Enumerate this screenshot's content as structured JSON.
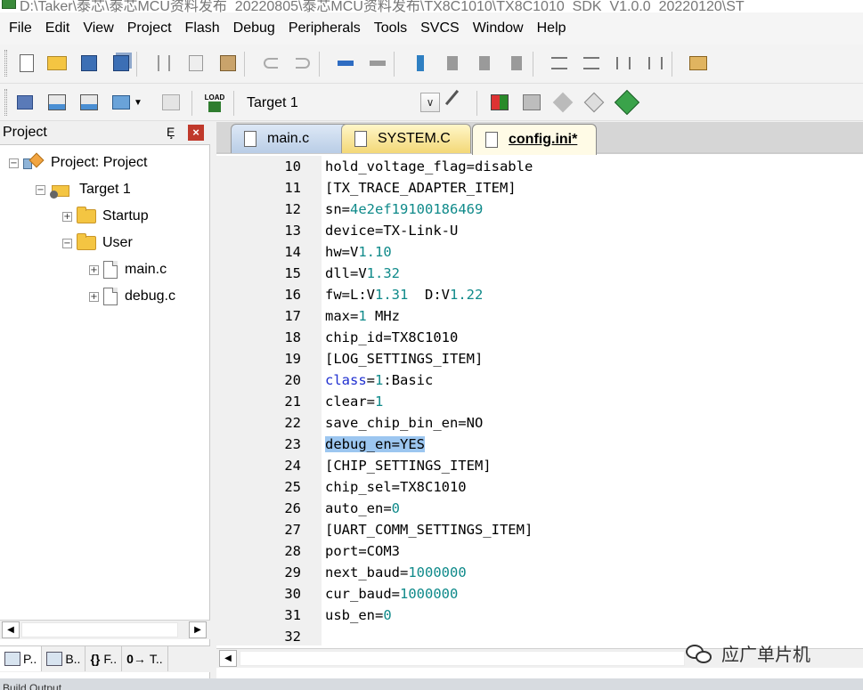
{
  "window": {
    "title": "D:\\Taker\\泰芯\\泰芯MCU资料发布_20220805\\泰芯MCU资料发布\\TX8C1010\\TX8C1010_SDK_V1.0.0_20220120\\ST"
  },
  "menu": [
    "File",
    "Edit",
    "View",
    "Project",
    "Flash",
    "Debug",
    "Peripherals",
    "Tools",
    "SVCS",
    "Window",
    "Help"
  ],
  "toolbar1": {
    "icons": [
      "new-file-icon",
      "open-folder-icon",
      "save-icon",
      "save-all-icon",
      "cut-icon",
      "copy-icon",
      "paste-icon",
      "undo-icon",
      "redo-icon",
      "navigate-back-icon",
      "navigate-forward-icon",
      "insert-bookmark-icon",
      "previous-bookmark-icon",
      "next-bookmark-icon",
      "clear-bookmarks-icon",
      "indent-icon",
      "unindent-icon",
      "comment-icon",
      "uncomment-icon",
      "find-in-files-icon"
    ]
  },
  "toolbar2": {
    "target_value": "Target 1",
    "load_label": "LOAD"
  },
  "project_panel": {
    "title": "Project",
    "pin": "Ȩ",
    "close": "×",
    "tree": [
      {
        "label": "Project: Project",
        "level": 0,
        "expander": "−",
        "type": "project"
      },
      {
        "label": "Target 1",
        "level": 1,
        "expander": "−",
        "type": "target"
      },
      {
        "label": "Startup",
        "level": 2,
        "expander": "+",
        "type": "folder"
      },
      {
        "label": "User",
        "level": 2,
        "expander": "−",
        "type": "folder"
      },
      {
        "label": "main.c",
        "level": 3,
        "expander": "+",
        "type": "file"
      },
      {
        "label": "debug.c",
        "level": 3,
        "expander": "+",
        "type": "file"
      }
    ],
    "bottom_tabs": [
      "P..",
      "B..",
      "F..",
      "T.."
    ],
    "bottom_tab_glyphs": [
      "",
      "",
      "{}",
      "0→"
    ]
  },
  "editor": {
    "tabs": [
      {
        "label": "main.c",
        "active": false
      },
      {
        "label": "SYSTEM.C",
        "active": false
      },
      {
        "label": "config.ini*",
        "active": true
      }
    ],
    "lines": [
      {
        "no": "10",
        "parts": [
          [
            "hold_voltage_flag=disable",
            ""
          ]
        ]
      },
      {
        "no": "11",
        "parts": [
          [
            "[TX_TRACE_ADAPTER_ITEM]",
            ""
          ]
        ]
      },
      {
        "no": "12",
        "parts": [
          [
            "sn=",
            ""
          ],
          [
            "4e2ef19100186469",
            "num"
          ]
        ]
      },
      {
        "no": "13",
        "parts": [
          [
            "device=TX-Link-U",
            ""
          ]
        ]
      },
      {
        "no": "14",
        "parts": [
          [
            "hw=V",
            ""
          ],
          [
            "1.10",
            "num"
          ]
        ]
      },
      {
        "no": "15",
        "parts": [
          [
            "dll=V",
            ""
          ],
          [
            "1.32",
            "num"
          ]
        ]
      },
      {
        "no": "16",
        "parts": [
          [
            "fw=L:V",
            ""
          ],
          [
            "1.31",
            "num"
          ],
          [
            "  D:V",
            ""
          ],
          [
            "1.22",
            "num"
          ]
        ]
      },
      {
        "no": "17",
        "parts": [
          [
            "max=",
            ""
          ],
          [
            "1",
            "num"
          ],
          [
            " MHz",
            ""
          ]
        ]
      },
      {
        "no": "18",
        "parts": [
          [
            "chip_id=TX8C1010",
            ""
          ]
        ]
      },
      {
        "no": "19",
        "parts": [
          [
            "[LOG_SETTINGS_ITEM]",
            ""
          ]
        ]
      },
      {
        "no": "20",
        "parts": [
          [
            "class",
            "kw"
          ],
          [
            "=",
            ""
          ],
          [
            "1",
            "num"
          ],
          [
            ":Basic",
            ""
          ]
        ]
      },
      {
        "no": "21",
        "parts": [
          [
            "clear=",
            ""
          ],
          [
            "1",
            "num"
          ]
        ]
      },
      {
        "no": "22",
        "parts": [
          [
            "save_chip_bin_en=NO",
            ""
          ]
        ]
      },
      {
        "no": "23",
        "parts": [
          [
            "debug_en=YES",
            "hl"
          ]
        ]
      },
      {
        "no": "24",
        "parts": [
          [
            "[CHIP_SETTINGS_ITEM]",
            ""
          ]
        ]
      },
      {
        "no": "25",
        "parts": [
          [
            "chip_sel=TX8C1010",
            ""
          ]
        ]
      },
      {
        "no": "26",
        "parts": [
          [
            "auto_en=",
            ""
          ],
          [
            "0",
            "num"
          ]
        ]
      },
      {
        "no": "27",
        "parts": [
          [
            "[UART_COMM_SETTINGS_ITEM]",
            ""
          ]
        ]
      },
      {
        "no": "28",
        "parts": [
          [
            "port=COM3",
            ""
          ]
        ]
      },
      {
        "no": "29",
        "parts": [
          [
            "next_baud=",
            ""
          ],
          [
            "1000000",
            "num"
          ]
        ]
      },
      {
        "no": "30",
        "parts": [
          [
            "cur_baud=",
            ""
          ],
          [
            "1000000",
            "num"
          ]
        ]
      },
      {
        "no": "31",
        "parts": [
          [
            "usb_en=",
            ""
          ],
          [
            "0",
            "num"
          ]
        ]
      },
      {
        "no": "32",
        "parts": [
          [
            "",
            ""
          ]
        ]
      }
    ]
  },
  "watermark": {
    "text": "应广单片机"
  },
  "bottom": {
    "text": "Build Output"
  },
  "colors": {
    "number": "#0f8a8a",
    "keyword": "#1f2fd0",
    "selection": "#9cc6f0"
  }
}
